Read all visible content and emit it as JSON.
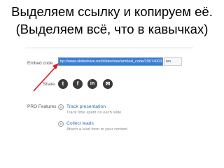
{
  "slide": {
    "title_line1": "Выделяем ссылку и копируем её.",
    "title_line2": "(Выделяем всё, что в кавычках)"
  },
  "embed": {
    "label": "Embed code",
    "value": "ttp://www.slideshare.net/slideshow/embed_code/29074003",
    "size_select": "wo"
  },
  "share": {
    "label": "Share",
    "icons": [
      "twitter-icon",
      "facebook-icon",
      "linkedin-icon",
      "email-icon"
    ]
  },
  "pro": {
    "label": "PRO Features",
    "features": [
      {
        "title": "Track presentation",
        "desc": "Track time spent on each slide"
      },
      {
        "title": "Collect leads",
        "desc": "Attach a lead form to your content"
      }
    ]
  },
  "colors": {
    "selection": "#3b7fd4",
    "link": "#2d6fb5",
    "arrow": "#e0191e"
  }
}
